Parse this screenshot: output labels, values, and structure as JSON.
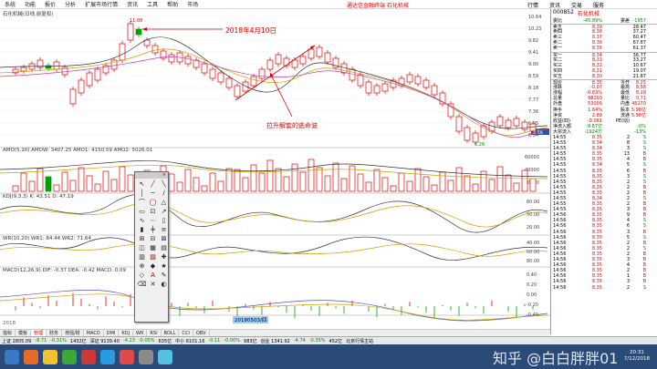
{
  "menu": {
    "items": [
      "系统",
      "功能",
      "报价",
      "分析",
      "扩展市场行情",
      "资讯",
      "工具",
      "帮助"
    ],
    "market_label": "市场",
    "window_title": "通达信金融终端 石化机械",
    "right_items": [
      "行情",
      "资讯",
      "交易",
      "服务"
    ]
  },
  "chart": {
    "title": "石化机械(日线,前复权)",
    "annotation_date": "2018年4月10日",
    "annotation_text": "拉升解套的逃命波",
    "high_label": "11.08",
    "low_label": "6.26",
    "price_ticks": [
      "10.64",
      "10.23",
      "9.82",
      "9.41",
      "9.00",
      "8.59",
      "8.18",
      "7.77",
      "7.36",
      "6.95",
      "6.54"
    ],
    "last_price_tag": "8.56",
    "amo_label": "AMO(5,10)  AMOW: 3407.25  AMO1: 4150.59  AMO2: 5026.01",
    "amo_ticks": [
      "60000",
      "40000",
      "20000"
    ],
    "kdj_label": "KDJ(9,3,3)  K: 43.51  D: 47.19",
    "kdj_ticks": [
      "80.00",
      "50.00",
      "20.00"
    ],
    "wr_label": "WR(10,20)  WR1: 84.44  WR2: 71.64",
    "wr_ticks": [
      "40.00",
      "60.00",
      "80.00"
    ],
    "macd_label": "MACD(12,26,9)  DIF: -0.37  DEA: -0.42  MACD: 0.09",
    "macd_ticks": [
      "0.40",
      "0.20",
      "0.00",
      "-0.20",
      "-0.40"
    ],
    "date_tag": "20180503/四",
    "axis_start": "2018"
  },
  "quote": {
    "code": "000852",
    "name": "石化机械",
    "header_rows": [
      {
        "k": "委比",
        "v": "-45.89%",
        "k2": "委差",
        "v2": "-1957",
        "cls": "grn"
      }
    ],
    "asks": [
      {
        "k": "卖五",
        "p": "8.39",
        "v": "28.47"
      },
      {
        "k": "卖四",
        "p": "8.38",
        "v": "37.27"
      },
      {
        "k": "卖三",
        "p": "8.37",
        "v": "60.47"
      },
      {
        "k": "卖二",
        "p": "8.36",
        "v": "67.87"
      },
      {
        "k": "卖一",
        "p": "8.35",
        "v": "61.37"
      }
    ],
    "bids": [
      {
        "k": "买一",
        "p": "8.34",
        "v": "36.77"
      },
      {
        "k": "买二",
        "p": "8.33",
        "v": "33.27"
      },
      {
        "k": "买三",
        "p": "8.32",
        "v": "10.67"
      },
      {
        "k": "买四",
        "p": "8.31",
        "v": "19.07"
      },
      {
        "k": "买五",
        "p": "8.30",
        "v": "21.87"
      }
    ],
    "stats": [
      {
        "k": "现价",
        "v": "8.35",
        "k2": "今开",
        "v2": "8.25"
      },
      {
        "k": "涨跌",
        "v": "-0.07",
        "k2": "最高",
        "v2": "8.58"
      },
      {
        "k": "涨幅",
        "v": "-0.83%",
        "k2": "最低",
        "v2": "8.18"
      },
      {
        "k": "总量",
        "v": "98203",
        "k2": "量比",
        "v2": "0.71"
      },
      {
        "k": "外盘",
        "v": "53005",
        "k2": "内盘",
        "v2": "45270"
      },
      {
        "k": "换手",
        "v": "1.64%",
        "k2": "股本",
        "v2": "5.98亿"
      },
      {
        "k": "净资",
        "v": "2.89",
        "k2": "流通",
        "v2": "5.98亿"
      },
      {
        "k": "收益(四)",
        "v": "-0.061",
        "k2": "PE(动)",
        "v2": ""
      }
    ],
    "flow": [
      {
        "k": "净流入额",
        "v": "-9.87亿",
        "r": "-0%"
      },
      {
        "k": "大宗流入",
        "v": "-1924万",
        "r": "-13%"
      }
    ],
    "ticks": [
      {
        "t": "14:55",
        "p": "8.35",
        "v": "2",
        "f": "S"
      },
      {
        "t": "14:55",
        "p": "8.34",
        "v": "8",
        "f": "S"
      },
      {
        "t": "14:55",
        "p": "8.34",
        "v": "3",
        "f": "S"
      },
      {
        "t": "14:55",
        "p": "8.35",
        "v": "13",
        "f": "B"
      },
      {
        "t": "14:55",
        "p": "8.35",
        "v": "4",
        "f": "B"
      },
      {
        "t": "14:55",
        "p": "8.34",
        "v": "5",
        "f": "S"
      },
      {
        "t": "14:55",
        "p": "8.35",
        "v": "6",
        "f": "B"
      },
      {
        "t": "14:55",
        "p": "8.35",
        "v": "3",
        "f": "S"
      },
      {
        "t": "14:55",
        "p": "8.35",
        "v": "2",
        "f": "S"
      },
      {
        "t": "14:55",
        "p": "8.35",
        "v": "2",
        "f": "B"
      },
      {
        "t": "14:55",
        "p": "8.35",
        "v": "2",
        "f": "B"
      },
      {
        "t": "14:55",
        "p": "8.34",
        "v": "2",
        "f": "S"
      },
      {
        "t": "14:55",
        "p": "8.35",
        "v": "2",
        "f": "B"
      },
      {
        "t": "14:55",
        "p": "8.35",
        "v": "3",
        "f": "B"
      },
      {
        "t": "14:56",
        "p": "8.35",
        "v": "9",
        "f": "B"
      },
      {
        "t": "14:56",
        "p": "8.35",
        "v": "4",
        "f": "S"
      },
      {
        "t": "14:56",
        "p": "8.35",
        "v": "6",
        "f": "S"
      },
      {
        "t": "14:56",
        "p": "8.35",
        "v": "3",
        "f": "B"
      },
      {
        "t": "14:56",
        "p": "8.35",
        "v": "5",
        "f": "S"
      },
      {
        "t": "14:56",
        "p": "8.35",
        "v": "2",
        "f": "B"
      },
      {
        "t": "14:56",
        "p": "8.35",
        "v": "2",
        "f": "S"
      },
      {
        "t": "14:56",
        "p": "8.35",
        "v": "2",
        "f": "B"
      },
      {
        "t": "14:56",
        "p": "8.35",
        "v": "3",
        "f": "B"
      },
      {
        "t": "14:56",
        "p": "8.35",
        "v": "4",
        "f": "B"
      },
      {
        "t": "14:56",
        "p": "8.35",
        "v": "2",
        "f": "B"
      },
      {
        "t": "14:56",
        "p": "8.35",
        "v": "1",
        "f": "B"
      },
      {
        "t": "14:56",
        "p": "8.35",
        "v": "3",
        "f": "B"
      },
      {
        "t": "14:56",
        "p": "8.35",
        "v": "2",
        "f": "S"
      }
    ]
  },
  "tabs": [
    "指标",
    "模板",
    "管理",
    "财务",
    "增强/财",
    "MACD",
    "DMI",
    "KDJ",
    "WR",
    "RSI",
    "BOLL",
    "CCI",
    "OBV"
  ],
  "status": {
    "items": [
      "上证 2805.09",
      "-8.71",
      "-0.31%",
      "1432亿",
      "深证 9139.40",
      "-4.23",
      "-0.05%",
      "635亿",
      "中小 6101.16",
      "-0.11",
      "-0.00%",
      "983亿",
      "创业 1341.92",
      "-4.74",
      "-0.35%",
      "452亿",
      "北京行情主站"
    ]
  },
  "taskbar": {
    "clock_time": "20:31",
    "clock_date": "7/12/2018",
    "watermark": "知乎 @白白胖胖01"
  },
  "colors": {
    "up": "#e00000",
    "down": "#00a000",
    "dif": "#5050c8",
    "dea": "#d0a000"
  }
}
